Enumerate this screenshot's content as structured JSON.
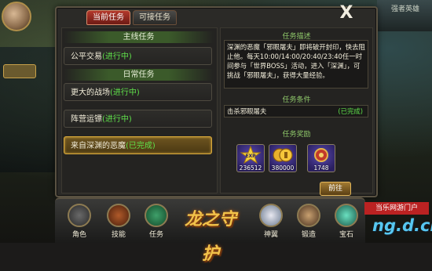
{
  "tabs": {
    "current": "当前任务",
    "available": "可接任务"
  },
  "close_label": "X",
  "quest_list": {
    "main_header": "主线任务",
    "main_item": {
      "name": "公平交易",
      "status": "(进行中)"
    },
    "daily_header": "日常任务",
    "daily_items": [
      {
        "name": "更大的战场",
        "status": "(进行中)"
      },
      {
        "name": "阵营运镖",
        "status": "(进行中)"
      },
      {
        "name": "来自深渊的恶魔",
        "status": "(已完成)"
      }
    ]
  },
  "detail": {
    "desc_title": "任务描述",
    "description": "深渊的恶魔「邪眼屠夫」即将破开封印，快去阻止他。每天10:00/14:00/20:40/23:40任一时间参与「世界BOSS」活动，进入「深渊」，可挑战「邪眼屠夫」，获得大量经验。",
    "cond_title": "任务条件",
    "condition": "击杀邪眼屠夫",
    "condition_status": "(已完成)",
    "reward_title": "任务奖励",
    "rewards": [
      {
        "icon": "exp-star-icon",
        "count": "236512"
      },
      {
        "icon": "gold-coin-icon",
        "count": "380000"
      },
      {
        "icon": "medal-icon",
        "count": "1748"
      }
    ],
    "go_button": "前往"
  },
  "bottom_bar": {
    "items": [
      "角色",
      "技能",
      "任务",
      "神翼",
      "锻造",
      "宝石"
    ],
    "logo": "龙之守护"
  },
  "side": {
    "right_top_label": "强者英雄"
  },
  "watermark": {
    "top": "当乐网游门户",
    "big": "ng.d.cn"
  }
}
